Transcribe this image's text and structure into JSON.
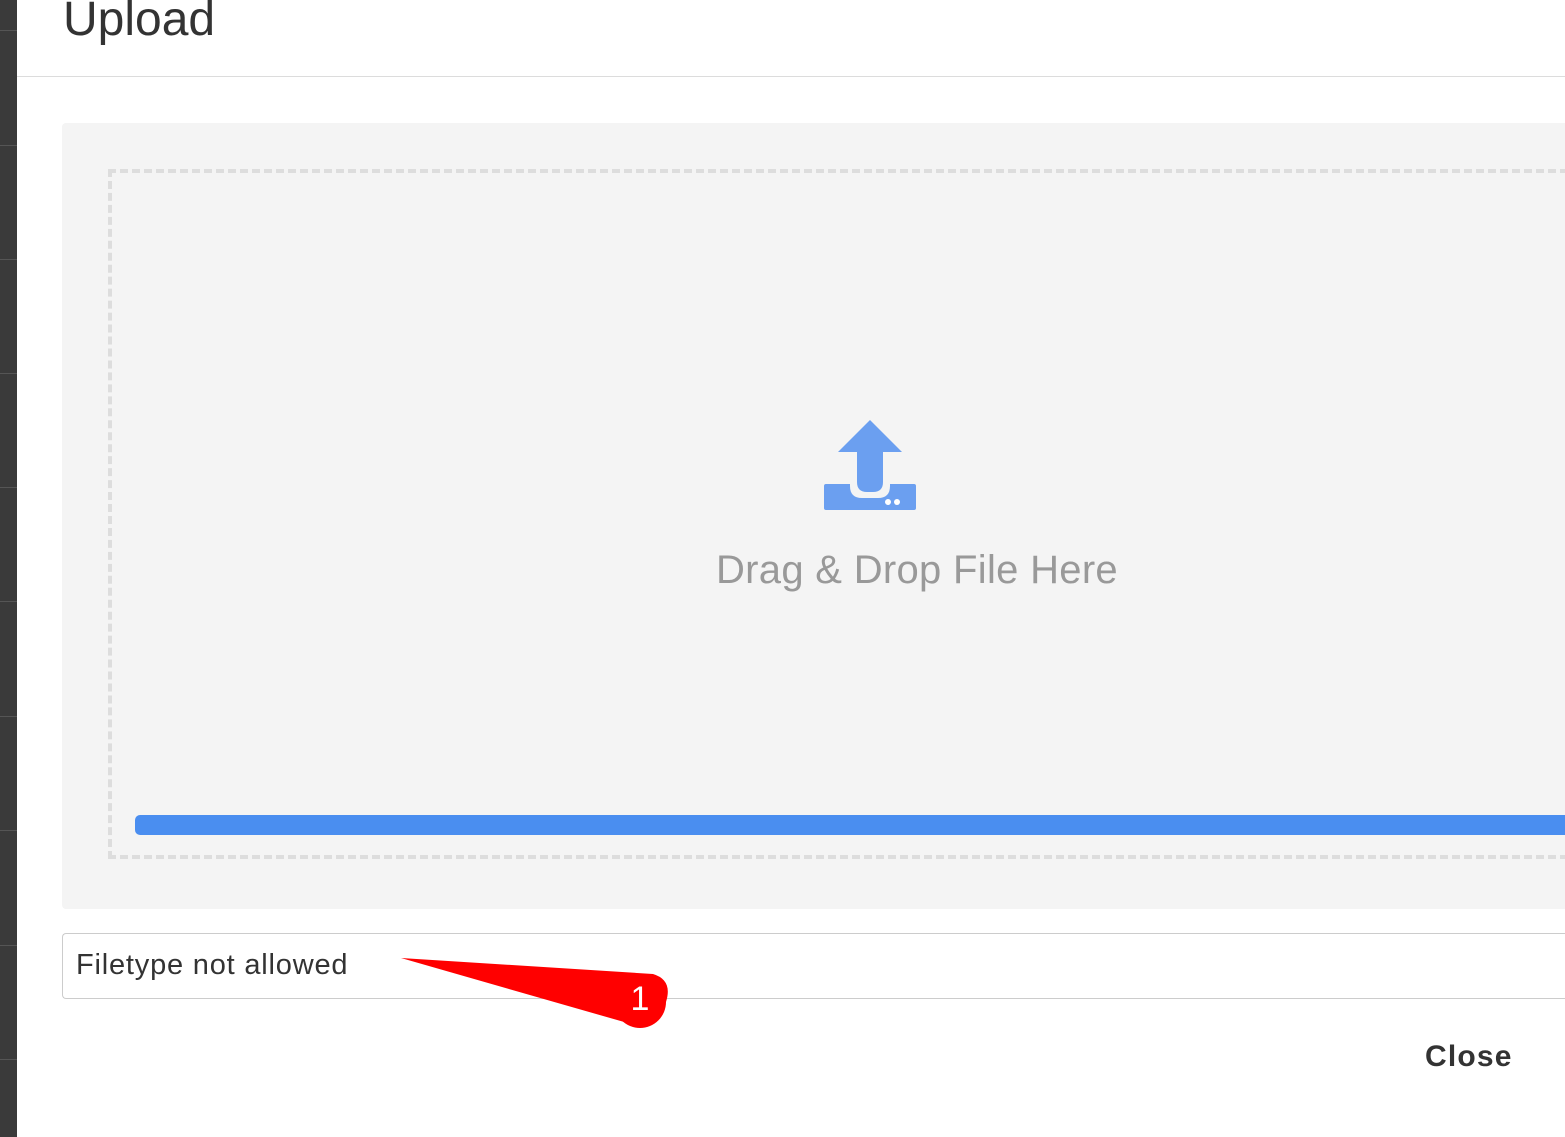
{
  "modal": {
    "title": "Upload",
    "dropzone": {
      "icon": "upload-tray-icon",
      "text": "Drag & Drop File Here",
      "progress_percent": 100
    },
    "error_message": "Filetype not allowed",
    "close_label": "Close"
  },
  "annotation": {
    "label": "1",
    "color": "#ff0000"
  },
  "colors": {
    "accent": "#4a8ef0",
    "icon": "#6b9ff0"
  }
}
